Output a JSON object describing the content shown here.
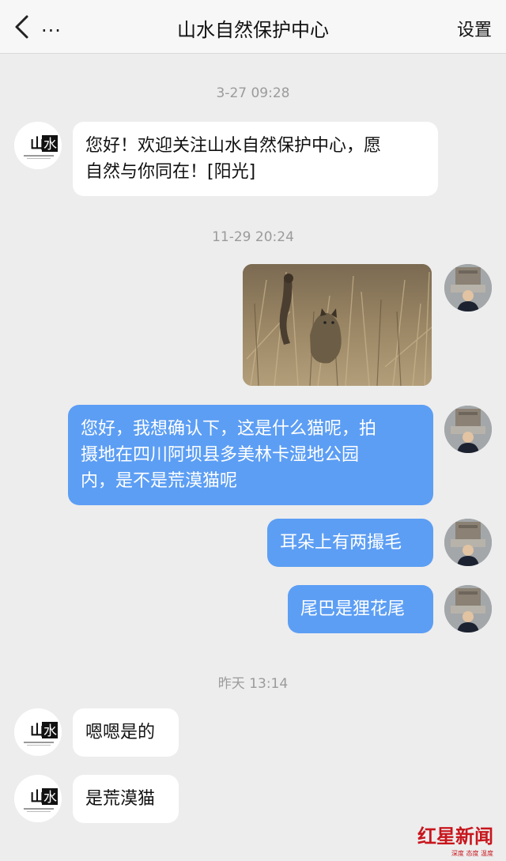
{
  "header": {
    "back_icon": "chevron-left-icon",
    "more_label": "...",
    "title": "山水自然保护中心",
    "settings_label": "设置"
  },
  "org_avatar": {
    "logo_text": "山水",
    "caption": "山水自然保护中心",
    "caption_en": "Shan Shui Conservation Center"
  },
  "messages": [
    {
      "time": "3-27 09:28"
    },
    {
      "side": "left",
      "text_lines": [
        "您好！欢迎关注山水自然保护中心，愿",
        "自然与你同在！[阳光]"
      ]
    },
    {
      "time": "11-29 20:24"
    },
    {
      "side": "right",
      "type": "image",
      "alt": "photo"
    },
    {
      "side": "right",
      "text_lines": [
        "您好，我想确认下，这是什么猫呢，拍",
        "摄地在四川阿坝县多美林卡湿地公园",
        "内，是不是荒漠猫呢"
      ]
    },
    {
      "side": "right",
      "text_lines": [
        "耳朵上有两撮毛"
      ]
    },
    {
      "side": "right",
      "text_lines": [
        "尾巴是狸花尾"
      ]
    },
    {
      "time": "昨天 13:14"
    },
    {
      "side": "left",
      "text_lines": [
        "嗯嗯是的"
      ]
    },
    {
      "side": "left",
      "text_lines": [
        "是荒漠猫"
      ]
    }
  ],
  "watermark": {
    "main": "红星新闻",
    "sub": "深度 态度 温度"
  },
  "colors": {
    "bubble_right": "#5c9ef4",
    "bubble_left": "#ffffff",
    "background": "#ededed",
    "watermark": "#c8161d"
  }
}
